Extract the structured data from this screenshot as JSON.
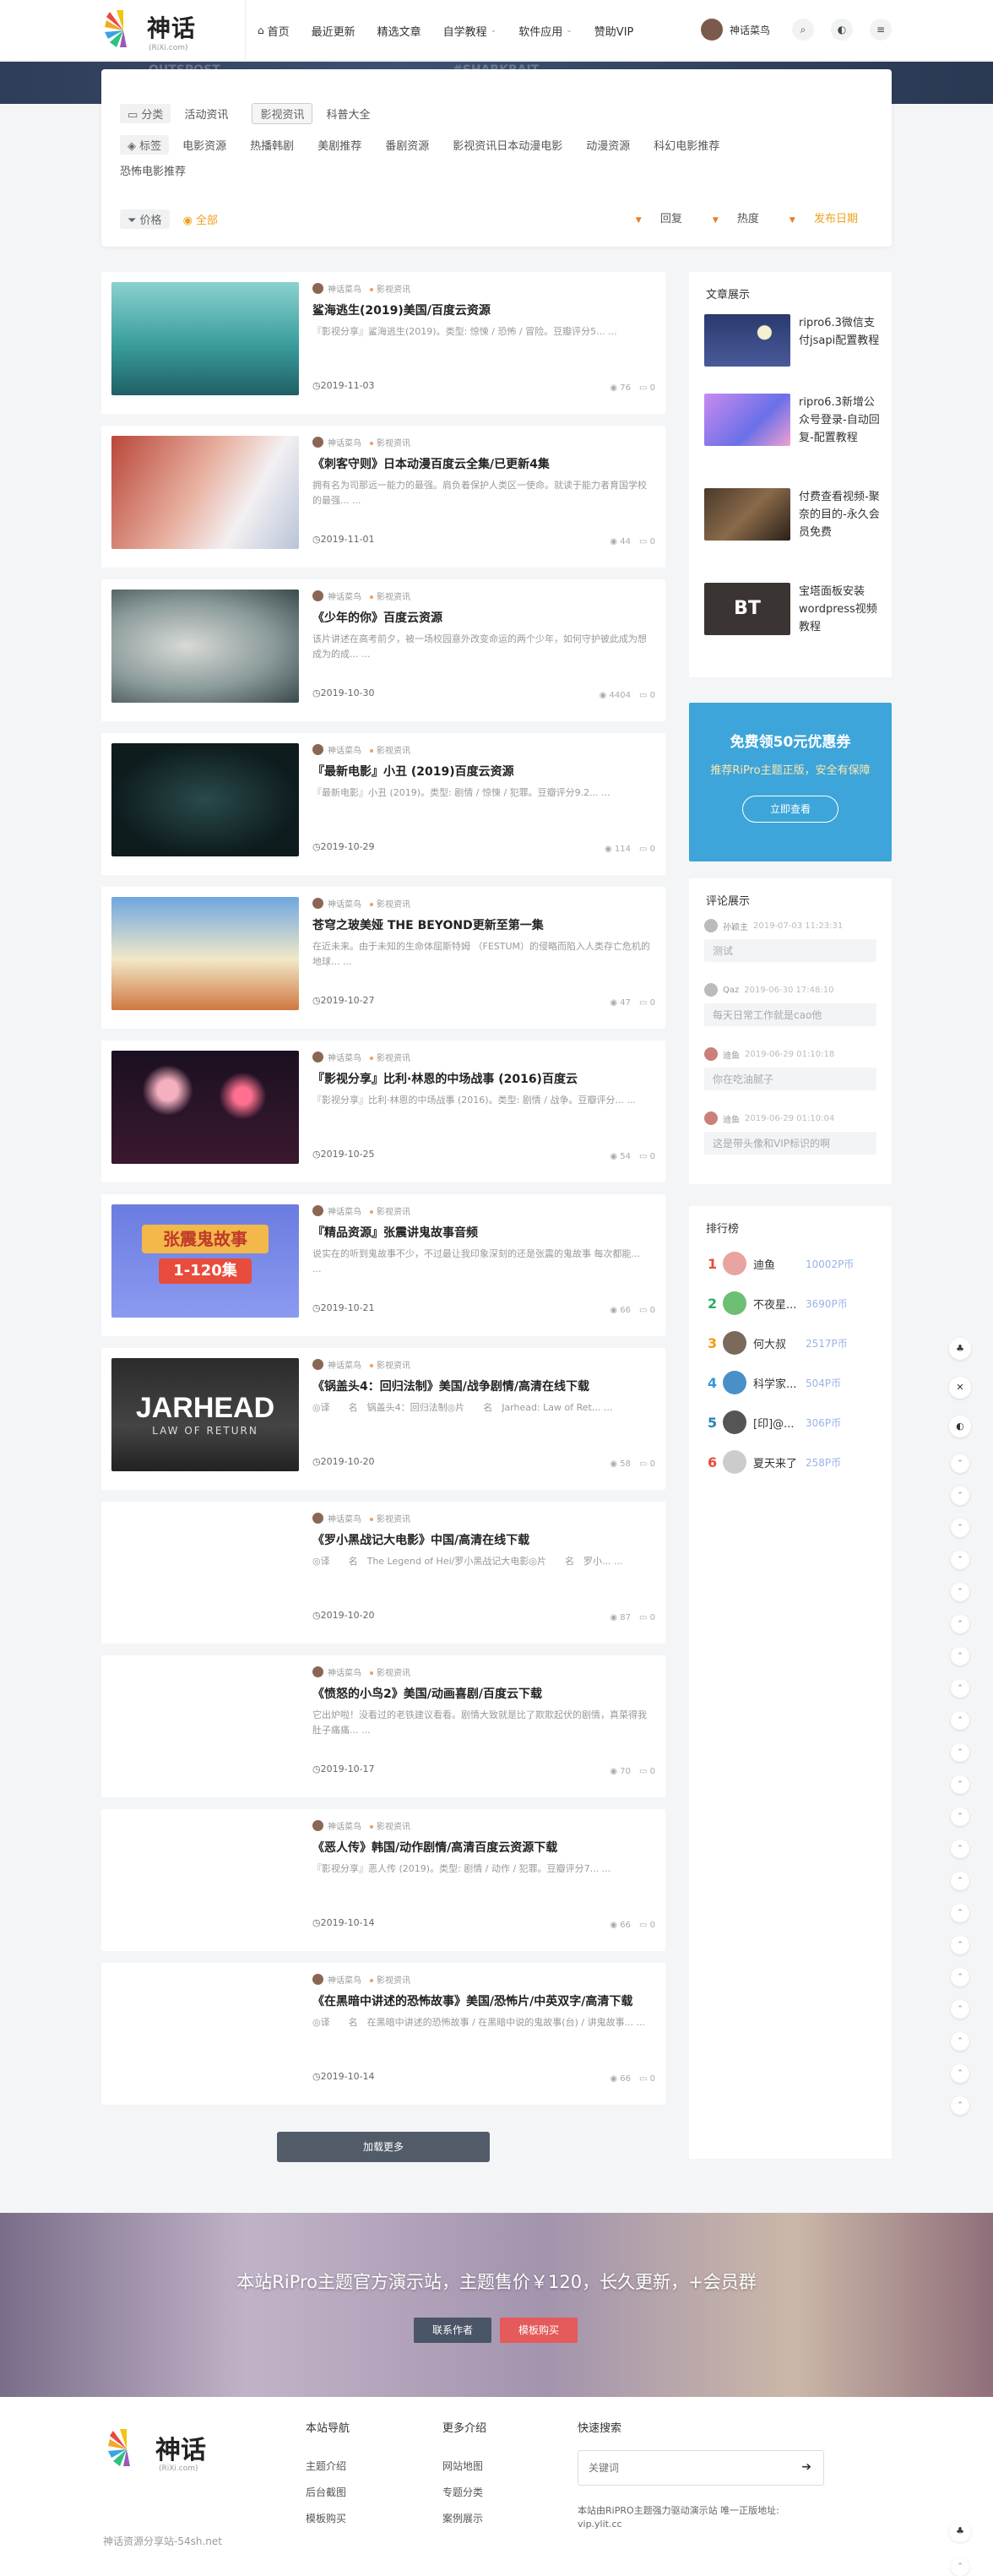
{
  "header": {
    "logo_text": "神话",
    "logo_sub": "(RiXi.com)",
    "nav": [
      {
        "label": "首页",
        "icon": "home-icon",
        "has_caret": false
      },
      {
        "label": "最近更新",
        "has_caret": false
      },
      {
        "label": "精选文章",
        "has_caret": false
      },
      {
        "label": "自学教程",
        "has_caret": true
      },
      {
        "label": "软件应用",
        "has_caret": true
      },
      {
        "label": "赞助VIP",
        "has_caret": false
      }
    ],
    "user_name": "神话菜鸟"
  },
  "banner_words": [
    "OUTSPOST",
    "#SHARKBAIT"
  ],
  "filter": {
    "category_chip": "分类",
    "categories": [
      "活动资讯",
      "影视资讯",
      "科普大全"
    ],
    "active_category": "影视资讯",
    "tag_chip": "标签",
    "tags": [
      "电影资源",
      "热播韩剧",
      "美剧推荐",
      "番剧资源",
      "影视资讯日本动漫电影",
      "动漫资源",
      "科幻电影推荐"
    ],
    "tags_row2": [
      "恐怖电影推荐"
    ],
    "price_chip": "价格",
    "price_all": "全部",
    "sorts": [
      "回复",
      "热度",
      "发布日期"
    ],
    "active_sort": "发布日期"
  },
  "posts": [
    {
      "author": "神话菜鸟",
      "category": "影视资讯",
      "title": "鲨海逃生(2019)美国/百度云资源",
      "excerpt": "『影视分享』鲨海逃生(2019)。类型: 惊悚 / 恐怖 / 冒险。豆瓣评分5...  ...",
      "date": "2019-11-03",
      "views": "76",
      "comments": "0",
      "thumb": "shark"
    },
    {
      "author": "神话菜鸟",
      "category": "影视资讯",
      "title": "《刺客守则》日本动漫百度云全集/已更新4集",
      "excerpt": "拥有名为司那远一能力的最强。肩负着保护人类区一使命。就读于能力者育国学校的最强...  ...",
      "date": "2019-11-01",
      "views": "44",
      "comments": "0",
      "thumb": "anime"
    },
    {
      "author": "神话菜鸟",
      "category": "影视资讯",
      "title": "《少年的你》百度云资源",
      "excerpt": "该片讲述在高考前夕，被一场校园意外改变命运的两个少年，如何守护彼此成为想成为的成...  ...",
      "date": "2019-10-30",
      "views": "4404",
      "comments": "0",
      "thumb": "ink"
    },
    {
      "author": "神话菜鸟",
      "category": "影视资讯",
      "title": "『最新电影』小丑 (2019)百度云资源",
      "excerpt": "『最新电影』小丑 (2019)。类型: 剧情 / 惊悚 / 犯罪。豆瓣评分9.2...  ...",
      "date": "2019-10-29",
      "views": "114",
      "comments": "0",
      "thumb": "dark"
    },
    {
      "author": "神话菜鸟",
      "category": "影视资讯",
      "title": "苍穹之玻美娅 THE BEYOND更新至第一集",
      "excerpt": "在近未来。由于未知的生命体屈斯特姆 （FESTUM）的侵略而陷入人类存亡危机的地球...  ...",
      "date": "2019-10-27",
      "views": "47",
      "comments": "0",
      "thumb": "sky"
    },
    {
      "author": "神话菜鸟",
      "category": "影视资讯",
      "title": "『影视分享』比利·林恩的中场战事 (2016)百度云",
      "excerpt": "『影视分享』比利·林恩的中场战事 (2016)。类型: 剧情 / 战争。豆瓣评分...  ...",
      "date": "2019-10-25",
      "views": "54",
      "comments": "0",
      "thumb": "fireworks"
    },
    {
      "author": "神话菜鸟",
      "category": "影视资讯",
      "title": "『精品资源』张震讲鬼故事音频",
      "excerpt": "说实在的听到鬼故事不少，不过最让我印象深刻的还是张震的鬼故事 每次都能...  ...",
      "date": "2019-10-21",
      "views": "66",
      "comments": "0",
      "thumb": "story",
      "thumb_title": "张震鬼故事",
      "thumb_sub": "1-120集"
    },
    {
      "author": "神话菜鸟",
      "category": "影视资讯",
      "title": "《锅盖头4：回归法制》美国/战争剧情/高清在线下载",
      "excerpt": "◎译　　名　锅盖头4：回归法制◎片　　名　Jarhead: Law of Ret...  ...",
      "date": "2019-10-20",
      "views": "58",
      "comments": "0",
      "thumb": "jarhead",
      "thumb_title": "JARHEAD",
      "thumb_sub": "LAW OF RETURN"
    },
    {
      "author": "神话菜鸟",
      "category": "影视资讯",
      "title": "《罗小黑战记大电影》中国/高清在线下载",
      "excerpt": "◎译　　名　The Legend of Hei/罗小黑战记大电影◎片　　名　罗小...  ...",
      "date": "2019-10-20",
      "views": "87",
      "comments": "0",
      "thumb": "blank"
    },
    {
      "author": "神话菜鸟",
      "category": "影视资讯",
      "title": "《愤怒的小鸟2》美国/动画喜剧/百度云下载",
      "excerpt": "它出炉啦！没看过的老铁建议看看。剧情大致就是比了欺欺起伏的剧情，真菜得我肚子痛痛...  ...",
      "date": "2019-10-17",
      "views": "70",
      "comments": "0",
      "thumb": "blank"
    },
    {
      "author": "神话菜鸟",
      "category": "影视资讯",
      "title": "《恶人传》韩国/动作剧情/高清百度云资源下载",
      "excerpt": "『影视分享』恶人传 (2019)。类型: 剧情 / 动作 / 犯罪。豆瓣评分7...  ...",
      "date": "2019-10-14",
      "views": "66",
      "comments": "0",
      "thumb": "blank"
    },
    {
      "author": "神话菜鸟",
      "category": "影视资讯",
      "title": "《在黑暗中讲述的恐怖故事》美国/恐怖片/中英双字/高清下载",
      "excerpt": "◎译　　名　在黑暗中讲述的恐怖故事 / 在黑暗中说的鬼故事(台) / 讲鬼故事...  ...",
      "date": "2019-10-14",
      "views": "66",
      "comments": "0",
      "thumb": "blank"
    }
  ],
  "load_more": "加载更多",
  "sidebar": {
    "articles_title": "文章展示",
    "articles": [
      {
        "title": "ripro6.3微信支付jsapi配置教程",
        "img": "night"
      },
      {
        "title": "ripro6.3新增公众号登录-自动回复-配置教程",
        "img": "purple"
      },
      {
        "title": "付费查看视频-聚奈的目的-永久会员免费",
        "img": "film"
      },
      {
        "title": "宝塔面板安装wordpress视频教程",
        "img": "bt",
        "img_label": "BT"
      }
    ],
    "ad": {
      "title": "免费领50元优惠券",
      "subtitle": "推荐RiPro主题正版，安全有保障",
      "button": "立即查看"
    },
    "comments_title": "评论展示",
    "comments": [
      {
        "name": "孙颖主",
        "time": "2019-07-03 11:23:31",
        "text": "测试"
      },
      {
        "name": "Qaz",
        "time": "2019-06-30 17:48:10",
        "text": "每天日常工作就是cao他"
      },
      {
        "name": "迪鱼",
        "time": "2019-06-29 01:10:18",
        "text": "你在吃油腻子"
      },
      {
        "name": "迪鱼",
        "time": "2019-06-29 01:10:04",
        "text": "这是带头像和VIP标识的啊"
      }
    ],
    "rank_title": "排行榜",
    "ranks": [
      {
        "n": "1",
        "name": "迪鱼",
        "points": "10002P币",
        "color": "#e74c3c",
        "av": "#e8a4a0"
      },
      {
        "n": "2",
        "name": "不夜星...",
        "points": "3690P币",
        "color": "#27ae60",
        "av": "#6dbf73"
      },
      {
        "n": "3",
        "name": "何大叔",
        "points": "2517P币",
        "color": "#f39c12",
        "av": "#7a6a5c"
      },
      {
        "n": "4",
        "name": "科学家...",
        "points": "504P币",
        "color": "#3498db",
        "av": "#4a90c8"
      },
      {
        "n": "5",
        "name": "[印]@...",
        "points": "306P币",
        "color": "#2980b9",
        "av": "#555"
      },
      {
        "n": "6",
        "name": "夏天来了",
        "points": "258P币",
        "color": "#e74c3c",
        "av": "#ccc"
      }
    ]
  },
  "promo": {
    "text": "本站RiPro主题官方演示站，主题售价￥120，长久更新，+会员群",
    "btn1": "联系作者",
    "btn2": "模板购买"
  },
  "footer": {
    "brand_text": "神话",
    "brand_sub": "(RiXi.com)",
    "tagline": "神话资源分享站-54sh.net",
    "col1_title": "本站导航",
    "col1": [
      "主题介绍",
      "后台截图",
      "模板购买"
    ],
    "col2_title": "更多介绍",
    "col2": [
      "网站地图",
      "专题分类",
      "案例展示"
    ],
    "search_title": "快速搜索",
    "search_placeholder": "关键词",
    "note": "本站由RiPRO主题强力驱动演示站 唯一正版地址: vip.ylit.cc"
  }
}
